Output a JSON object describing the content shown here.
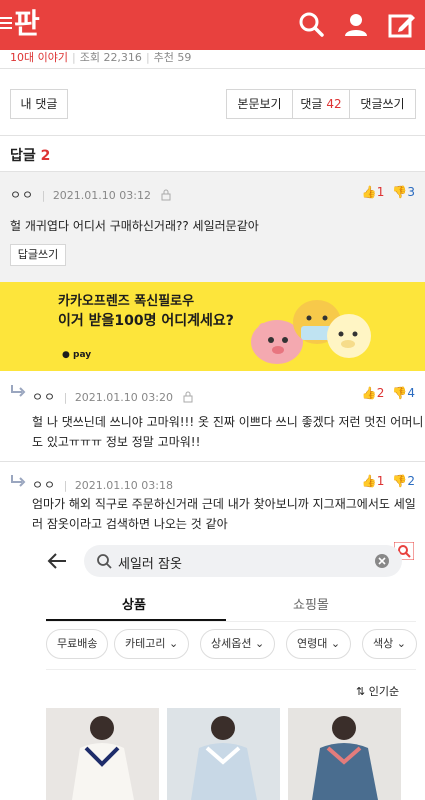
{
  "header": {
    "logo": "판",
    "icons": [
      "menu-icon",
      "search-icon",
      "user-icon",
      "write-icon"
    ]
  },
  "meta": {
    "category": "10대 이야기",
    "views": "조회 22,316",
    "recommend": "추천 59"
  },
  "actions": {
    "my_comments": "내 댓글",
    "view_post": "본문보기",
    "comments_label": "댓글",
    "comments_count": "42",
    "write_comment": "댓글쓰기"
  },
  "replies": {
    "title": "답글",
    "count": "2"
  },
  "comments": [
    {
      "author": "ㅇㅇ",
      "date": "2021.01.10 03:12",
      "up": "1",
      "down": "3",
      "text": "헐 개귀엽다 어디서 구매하신거래?? 세일러문같아",
      "reply_button": "답글쓰기"
    },
    {
      "author": "ㅇㅇ",
      "date": "2021.01.10 03:20",
      "up": "2",
      "down": "4",
      "text_line1": "헐 나 댓쓰닌데 쓰니야 고마워!!! 옷 진짜 이쁘다 쓰니 좋겠다 저런 멋진 어머니",
      "text_line2": "도 있고ㅠㅠㅠ 정보 정말 고마워!!"
    },
    {
      "author": "ㅇㅇ",
      "date": "2021.01.10 03:18",
      "up": "1",
      "down": "2",
      "text_line1": "엄마가 해외 직구로 주문하신거래 근데 내가 찾아보니까 지그재그에서도 세일",
      "text_line2": "러 잠옷이라고 검색하면 나오는 것 같아"
    }
  ],
  "banner": {
    "line1": "카카오프렌즈 폭신필로우",
    "line2": "이거 받을100명 어디계세요?",
    "brand": "pay",
    "colors": {
      "background": "#fde53b"
    }
  },
  "embedded_screenshot": {
    "search_query": "세일러 잠옷",
    "tab_active": "상품",
    "tab_other": "쇼핑몰",
    "chips": [
      "무료배송",
      "카테고리",
      "상세옵션",
      "연령대",
      "색상"
    ],
    "sort_label": "인기순"
  },
  "colors": {
    "brand": "#e8413e",
    "upvote": "#d33",
    "downvote": "#2b6cc0"
  }
}
